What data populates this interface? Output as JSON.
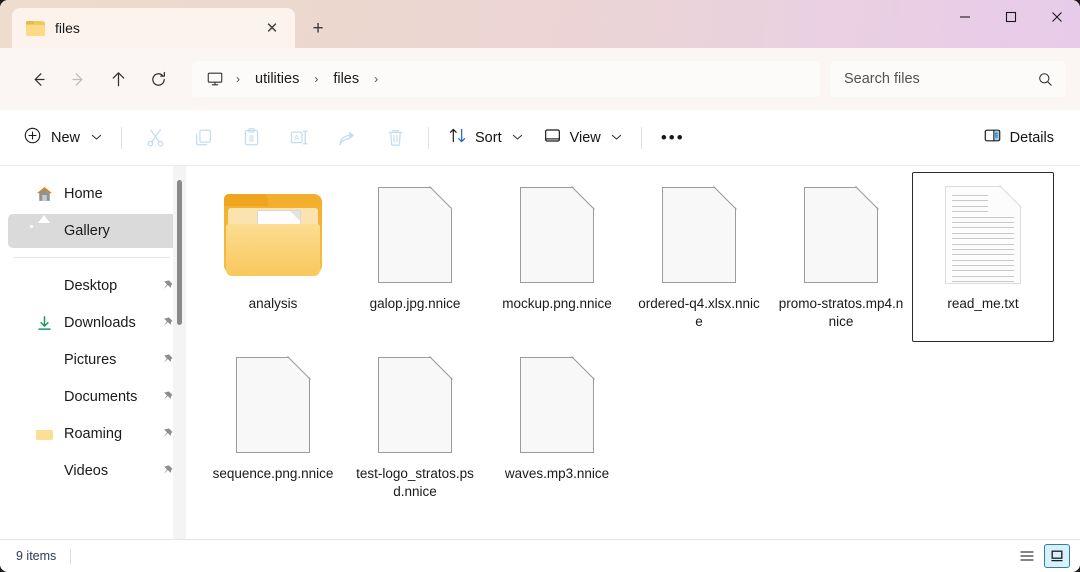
{
  "window": {
    "controls": {
      "minimize": "minimize-button",
      "maximize": "maximize-button",
      "close": "close-button"
    },
    "titlebar_gradient_start": "#eedccc",
    "titlebar_gradient_end": "#e8cbe9"
  },
  "tabs": {
    "items": [
      {
        "label": "files",
        "icon": "folder-icon",
        "active": true
      }
    ],
    "close_label": "✕",
    "new_tab_label": "+"
  },
  "nav": {
    "back": "←",
    "forward": "→",
    "up": "↑",
    "refresh": "↻"
  },
  "address": {
    "root_icon": "this-pc-icon",
    "crumbs": [
      "utilities",
      "files"
    ],
    "separator": "›",
    "trailing_separator": "›"
  },
  "search": {
    "placeholder": "Search files",
    "icon": "search-icon"
  },
  "toolbar": {
    "new_label": "New",
    "new_chevron": "⌄",
    "icons": [
      {
        "name": "cut-icon",
        "enabled": false
      },
      {
        "name": "copy-icon",
        "enabled": false
      },
      {
        "name": "paste-icon",
        "enabled": false
      },
      {
        "name": "rename-icon",
        "enabled": false
      },
      {
        "name": "share-icon",
        "enabled": false
      },
      {
        "name": "delete-icon",
        "enabled": false
      }
    ],
    "sort_label": "Sort",
    "view_label": "View",
    "overflow_label": "•••",
    "details_label": "Details",
    "chevron": "⌄"
  },
  "sidebar": {
    "items": [
      {
        "label": "Home",
        "icon": "home-icon",
        "pinned": false,
        "selected": false
      },
      {
        "label": "Gallery",
        "icon": "gallery-icon",
        "pinned": false,
        "selected": true
      },
      {
        "label": "Desktop",
        "icon": "desktop-icon",
        "pinned": true,
        "selected": false
      },
      {
        "label": "Downloads",
        "icon": "download-icon",
        "pinned": true,
        "selected": false
      },
      {
        "label": "Pictures",
        "icon": "pictures-icon",
        "pinned": true,
        "selected": false
      },
      {
        "label": "Documents",
        "icon": "documents-icon",
        "pinned": true,
        "selected": false
      },
      {
        "label": "Roaming",
        "icon": "folder-icon",
        "pinned": true,
        "selected": false
      },
      {
        "label": "Videos",
        "icon": "videos-icon",
        "pinned": true,
        "selected": false
      }
    ]
  },
  "files": [
    {
      "name": "analysis",
      "type": "folder-with-picture",
      "selected": false
    },
    {
      "name": "galop.jpg.nnice",
      "type": "generic-file",
      "selected": false
    },
    {
      "name": "mockup.png.nnice",
      "type": "generic-file",
      "selected": false
    },
    {
      "name": "ordered-q4.xlsx.nnice",
      "type": "generic-file",
      "selected": false
    },
    {
      "name": "promo-stratos.mp4.nnice",
      "type": "generic-file",
      "selected": false
    },
    {
      "name": "read_me.txt",
      "type": "text-file",
      "selected": true
    },
    {
      "name": "sequence.png.nnice",
      "type": "generic-file",
      "selected": false
    },
    {
      "name": "test-logo_stratos.psd.nnice",
      "type": "generic-file",
      "selected": false
    },
    {
      "name": "waves.mp3.nnice",
      "type": "generic-file",
      "selected": false
    }
  ],
  "status": {
    "item_count": "9 items",
    "view_list_icon": "list-view-icon",
    "view_tiles_icon": "tiles-view-icon",
    "view_tiles_active": true
  }
}
